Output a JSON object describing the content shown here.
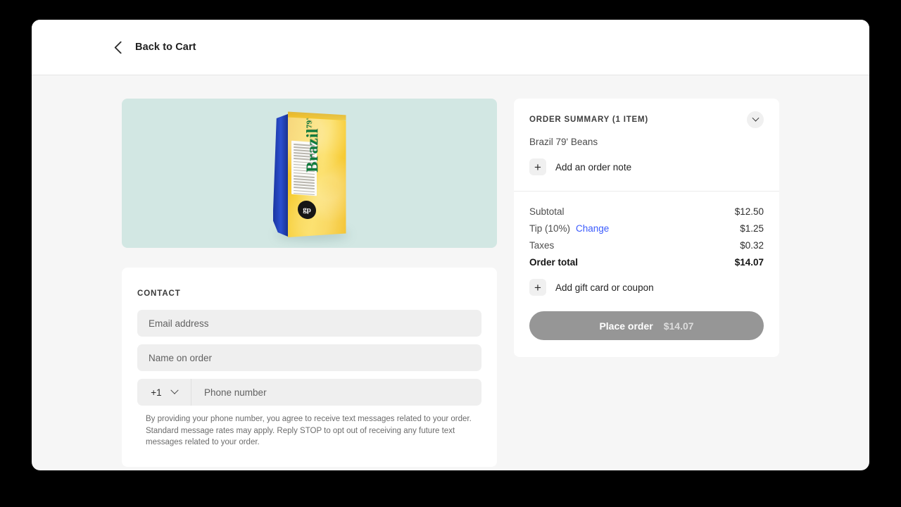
{
  "header": {
    "back_label": "Back to Cart",
    "back_icon": "chevron-left-icon"
  },
  "product": {
    "brand": "Brazil",
    "brand_sup": "79'",
    "badge": "gp",
    "background_color": "#d2e7e3"
  },
  "contact": {
    "section_label": "CONTACT",
    "email_placeholder": "Email address",
    "name_placeholder": "Name on order",
    "country_code": "+1",
    "phone_placeholder": "Phone number",
    "disclaimer": "By providing your phone number, you agree to receive text messages related to your order. Standard message rates may apply. Reply STOP to opt out of receiving any future text messages related to your order."
  },
  "summary": {
    "title": "ORDER SUMMARY (1 ITEM)",
    "collapse_icon": "chevron-down-icon",
    "item_name": "Brazil 79' Beans",
    "add_note_label": "Add an order note",
    "add_note_icon": "plus-icon",
    "rows": [
      {
        "label": "Subtotal",
        "amount": "$12.50",
        "link": ""
      },
      {
        "label": "Tip (10%)",
        "amount": "$1.25",
        "link": "Change"
      },
      {
        "label": "Taxes",
        "amount": "$0.32",
        "link": ""
      }
    ],
    "total_label": "Order total",
    "total_amount": "$14.07",
    "add_coupon_label": "Add gift card or coupon",
    "add_coupon_icon": "plus-icon",
    "place_order_label": "Place order",
    "place_order_amount": "$14.07",
    "link_color": "#3b5bfd",
    "button_color": "#969696"
  }
}
